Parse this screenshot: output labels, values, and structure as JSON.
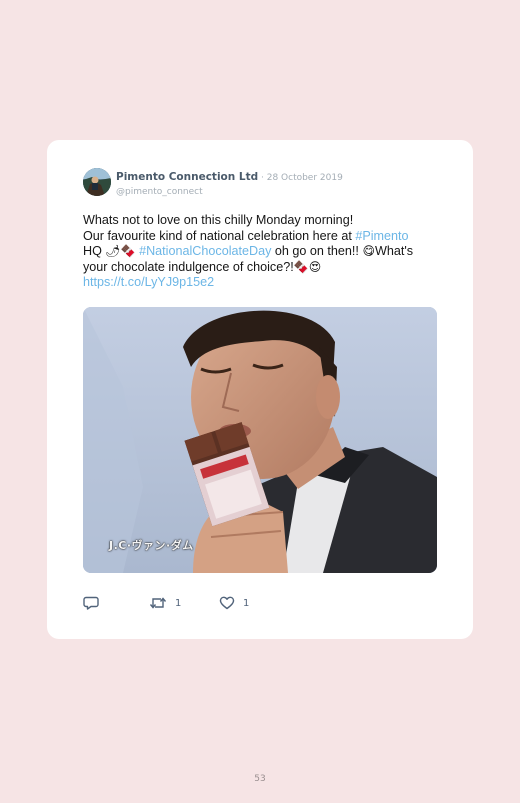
{
  "tweet": {
    "display_name": "Pimento Connection Ltd",
    "date_separator": " · ",
    "date": "28 October 2019",
    "handle": "@pimento_connect",
    "text": {
      "line1": "Whats not to love on this chilly Monday morning!",
      "line2_prefix": "Our favourite kind of national celebration here at ",
      "hashtag_pimento": "#Pimento",
      "line3_prefix": "HQ ",
      "emoji_chilli": "🌶",
      "emoji_chocolate": "🍫",
      "hashtag_chocolate_day": "#NationalChocolateDay",
      "line3_middle": " oh go on then!! ",
      "emoji_yum": "😋",
      "line3_suffix": "What's",
      "line4_prefix": "your chocolate indulgence of choice?!",
      "emoji_heart_eyes": "😍",
      "link": "https://t.co/LyYJ9p15e2"
    },
    "media": {
      "caption": "J.C·ヴァン·ダム"
    },
    "actions": {
      "reply_icon": "reply-icon",
      "retweet_icon": "retweet-icon",
      "retweet_count": "1",
      "like_icon": "heart-icon",
      "like_count": "1"
    }
  },
  "page_number": "53",
  "colors": {
    "page_background": "#f6e4e5",
    "card_background": "#ffffff",
    "link": "#6cb6e6",
    "muted": "#a4adb5",
    "name": "#4a5a6a"
  }
}
